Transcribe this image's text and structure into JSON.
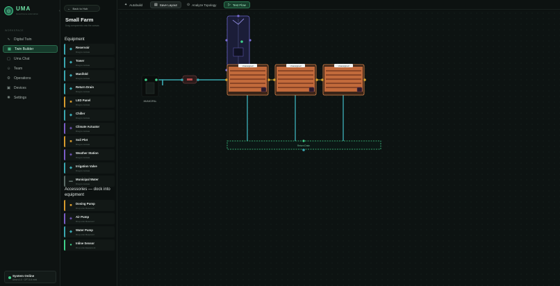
{
  "brand": {
    "name": "UMA",
    "tagline": "Greenhouse automation"
  },
  "nav": {
    "heading": "WORKSPACE",
    "items": [
      {
        "label": "Digital Twin",
        "icon": "pulse-icon"
      },
      {
        "label": "Twin Builder",
        "icon": "layers-icon",
        "active": true
      },
      {
        "label": "Uma Chat",
        "icon": "chat-icon"
      },
      {
        "label": "Team",
        "icon": "team-icon"
      },
      {
        "label": "Operations",
        "icon": "gear-icon"
      },
      {
        "label": "Devices",
        "icon": "device-icon"
      },
      {
        "label": "Settings",
        "icon": "settings-icon"
      }
    ]
  },
  "status": {
    "title": "System Online",
    "detail": "Uma v1.0 · GPT-5.4 mini"
  },
  "panel": {
    "back_label": "Back to Hub",
    "farm_name": "Small Farm",
    "farm_hint": "Drag components onto the canvas",
    "equipment_title": "Equipment",
    "equipment": [
      {
        "name": "Reservoir",
        "hint": "Drag to canvas",
        "color": "#3aa7b0"
      },
      {
        "name": "Tower",
        "hint": "Drag to canvas",
        "color": "#3aa7b0"
      },
      {
        "name": "Manifold",
        "hint": "Drag to canvas",
        "color": "#3aa7b0"
      },
      {
        "name": "Return Drain",
        "hint": "Drag to canvas",
        "color": "#3aa7b0"
      },
      {
        "name": "LED Panel",
        "hint": "Drag to canvas",
        "color": "#d69a2d"
      },
      {
        "name": "Chiller",
        "hint": "Drag to canvas",
        "color": "#3aa7b0"
      },
      {
        "name": "Climate Actuator",
        "hint": "Drag to canvas",
        "color": "#7a5cc6"
      },
      {
        "name": "Soil Plot",
        "hint": "Drag to canvas",
        "color": "#d69a2d"
      },
      {
        "name": "Weather Station",
        "hint": "Drag to canvas",
        "color": "#7a5cc6"
      },
      {
        "name": "Irrigation Valve",
        "hint": "Drag to canvas",
        "color": "#3aa7b0"
      },
      {
        "name": "Municipal Water",
        "hint": "Drag to canvas",
        "color": "#5b6b66"
      }
    ],
    "accessories_title": "Accessories — dock into equipment",
    "accessories": [
      {
        "name": "Dosing Pump",
        "hint": "Drop onto Reservoir",
        "color": "#d69a2d"
      },
      {
        "name": "Air Pump",
        "hint": "Drop onto Reservoir",
        "color": "#7a5cc6"
      },
      {
        "name": "Water Pump",
        "hint": "Drop onto Reservoir",
        "color": "#3aa7b0"
      },
      {
        "name": "Inline Sensor",
        "hint": "Drop onto Equipment",
        "color": "#3fd08a"
      }
    ]
  },
  "toolbar": {
    "autobuild": "Autobuild",
    "save": "Save Layout",
    "analyze": "Analyze Topology",
    "test": "Test Flow"
  },
  "canvas": {
    "municipal_label": "MUNICIPAL",
    "bed_label": "Unassigned",
    "drain_label": "Return Drain",
    "colors": {
      "bed": "#c26a3b",
      "pipe": "#3aa7b0",
      "tower": "#7b6fd6",
      "drain": "#3fd08a",
      "valve": "#e05a5a"
    }
  }
}
